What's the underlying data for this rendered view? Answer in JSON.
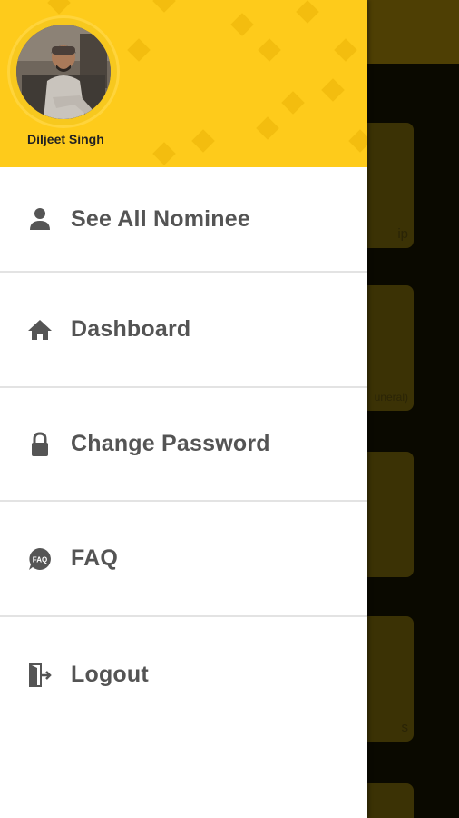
{
  "drawer": {
    "user_name": "Diljeet Singh",
    "header_color": "#fecb1b",
    "menu": [
      {
        "label": "See All Nominee",
        "icon": "person-icon"
      },
      {
        "label": "Dashboard",
        "icon": "home-icon"
      },
      {
        "label": "Change Password",
        "icon": "lock-icon"
      },
      {
        "label": "FAQ",
        "icon": "faq-icon",
        "icon_text": "FAQ"
      },
      {
        "label": "Logout",
        "icon": "logout-icon"
      }
    ]
  },
  "background": {
    "card_texts": [
      "ip",
      "uneral)",
      "s"
    ]
  }
}
